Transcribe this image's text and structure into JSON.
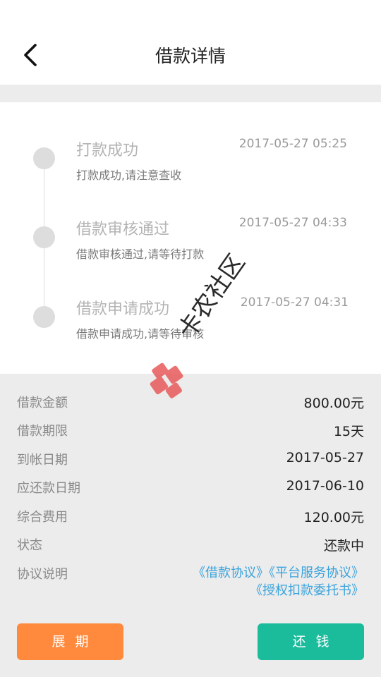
{
  "header": {
    "title": "借款详情"
  },
  "timeline": [
    {
      "title": "打款成功",
      "time": "2017-05-27 05:25",
      "desc": "打款成功,请注意查收"
    },
    {
      "title": "借款审核通过",
      "time": "2017-05-27 04:33",
      "desc": "借款审核通过,请等待打款"
    },
    {
      "title": "借款申请成功",
      "time": "2017-05-27 04:31",
      "desc": "借款申请成功,请等待审核"
    }
  ],
  "details": {
    "amount": {
      "label": "借款金额",
      "value": "800.00元"
    },
    "term": {
      "label": "借款期限",
      "value": "15天"
    },
    "arrival_date": {
      "label": "到帐日期",
      "value": "2017-05-27"
    },
    "repay_date": {
      "label": "应还款日期",
      "value": "2017-06-10"
    },
    "fee": {
      "label": "综合费用",
      "value": "120.00元"
    },
    "status": {
      "label": "状态",
      "value": "还款中"
    },
    "agreements": {
      "label": "协议说明",
      "loan": "《借款协议》",
      "platform": "《平台服务协议》",
      "authorization": "《授权扣款委托书》"
    }
  },
  "actions": {
    "extend_label": "展期",
    "repay_label": "还钱"
  },
  "watermark": {
    "text": "卡农社区"
  },
  "colors": {
    "extend": "#ff8a3d",
    "repay": "#1abc9c",
    "link": "#3aa3dc"
  }
}
